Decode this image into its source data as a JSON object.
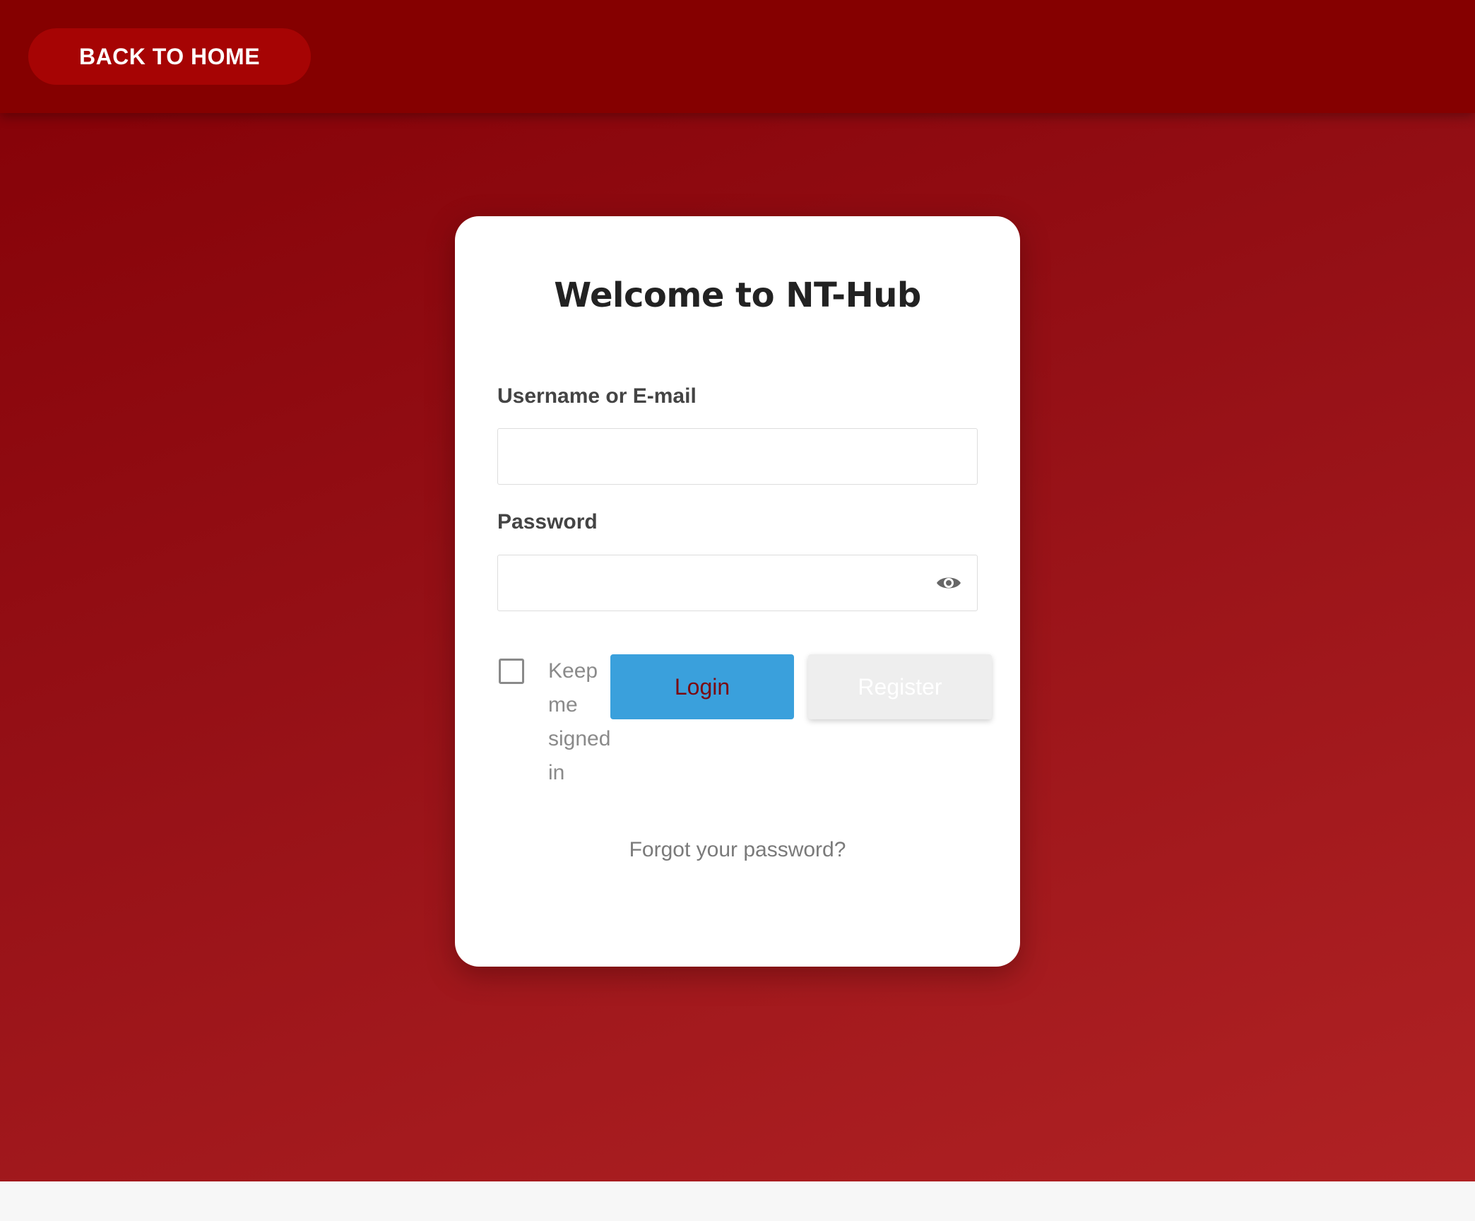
{
  "header": {
    "back_home_label": "BACK TO HOME"
  },
  "login_card": {
    "title": "Welcome to NT-Hub",
    "username_label": "Username or E-mail",
    "username_value": "",
    "password_label": "Password",
    "password_value": "",
    "password_toggle_icon": "eye-icon",
    "keep_signed_in_label": "Keep me signed in",
    "keep_signed_in_checked": false,
    "login_label": "Login",
    "register_label": "Register",
    "forgot_password_label": "Forgot your password?"
  },
  "colors": {
    "header_bg": "#850000",
    "back_home_bg": "#a60404",
    "login_button_bg": "#3aa0dc",
    "register_button_bg": "#eeeeee",
    "page_gradient_start": "#840006",
    "page_gradient_end": "#b02224"
  }
}
